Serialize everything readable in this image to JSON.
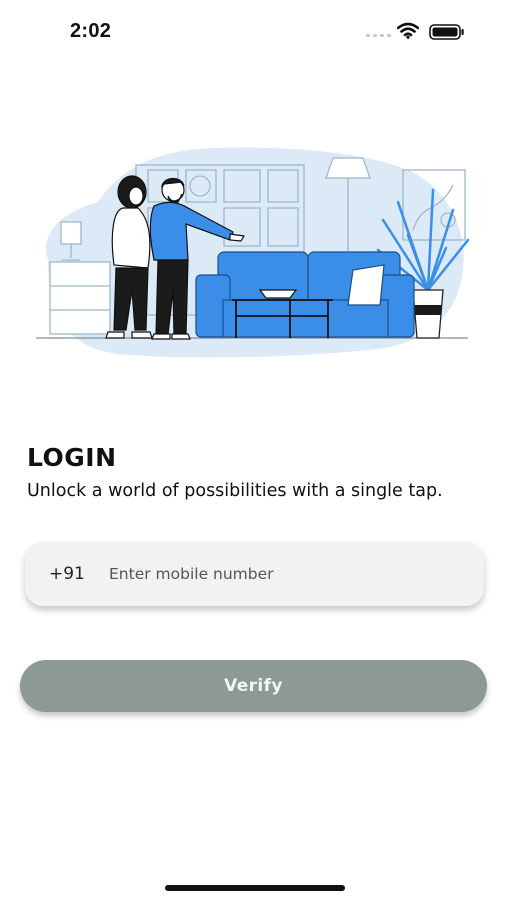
{
  "status_bar": {
    "time": "2:02",
    "signal_icon": "cellular-signal-icon",
    "wifi_icon": "wifi-icon",
    "battery_icon": "battery-icon"
  },
  "hero": {
    "illustration": "couple-living-room-illustration",
    "accent_color": "#3b8ee8"
  },
  "login": {
    "title": "LOGIN",
    "subtitle": "Unlock a world of possibilities with a single tap."
  },
  "phone_field": {
    "country_code": "+91",
    "value": "",
    "placeholder": "Enter mobile number"
  },
  "verify": {
    "label": "Verify",
    "color": "#8d9997"
  }
}
